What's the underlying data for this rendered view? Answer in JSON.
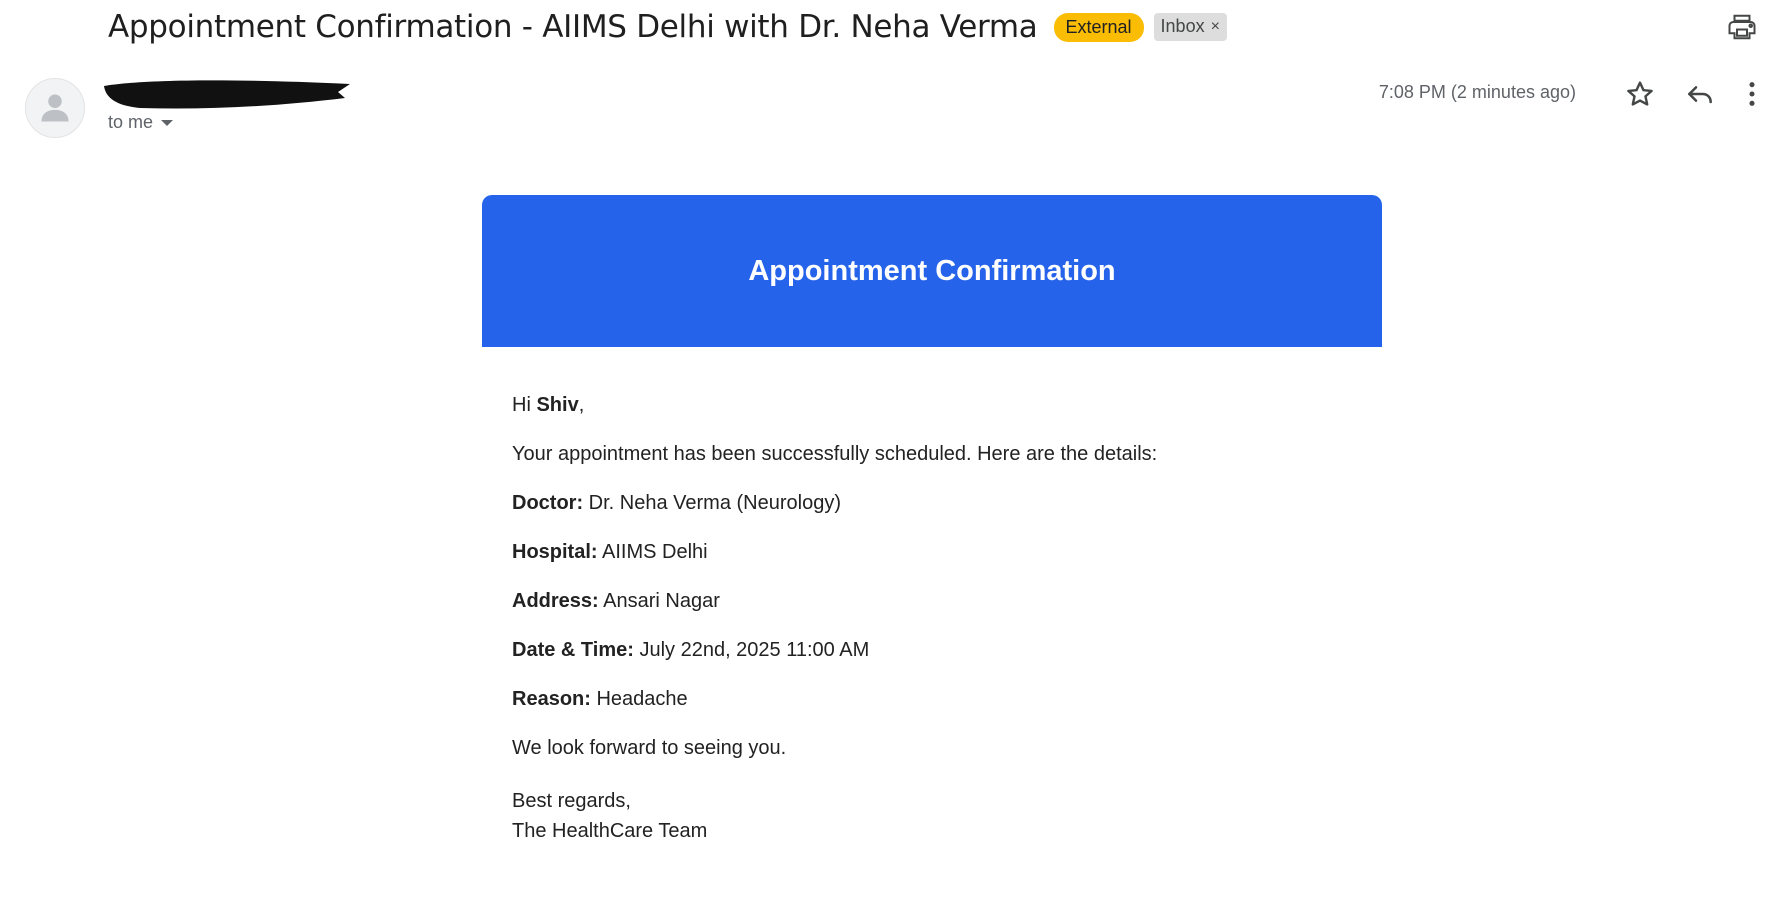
{
  "email": {
    "subject": "Appointment Confirmation - AIIMS Delhi with Dr. Neha Verma",
    "labels": {
      "external": "External",
      "inbox": "Inbox",
      "inbox_remove": "×"
    },
    "recipient_text": "to me",
    "timestamp": "7:08 PM (2 minutes ago)"
  },
  "message": {
    "banner_title": "Appointment Confirmation",
    "greeting_prefix": "Hi",
    "recipient_name": "Shiv",
    "greeting_suffix": ",",
    "intro": "Your appointment has been successfully scheduled. Here are the details:",
    "details": [
      {
        "label": "Doctor:",
        "value": "Dr. Neha Verma (Neurology)"
      },
      {
        "label": "Hospital:",
        "value": "AIIMS Delhi"
      },
      {
        "label": "Address:",
        "value": "Ansari Nagar"
      },
      {
        "label": "Date & Time:",
        "value": "July 22nd, 2025 11:00 AM"
      },
      {
        "label": "Reason:",
        "value": "Headache"
      }
    ],
    "closing": "We look forward to seeing you.",
    "signoff_line1": "Best regards,",
    "signoff_line2": "The HealthCare Team"
  },
  "icons": {
    "print": "print-icon",
    "star": "star-icon",
    "reply": "reply-icon",
    "more": "more-vertical-icon",
    "avatar": "person-icon"
  },
  "colors": {
    "banner": "#2563eb",
    "external_chip": "#fbbc04",
    "inbox_chip": "#dddddd"
  }
}
